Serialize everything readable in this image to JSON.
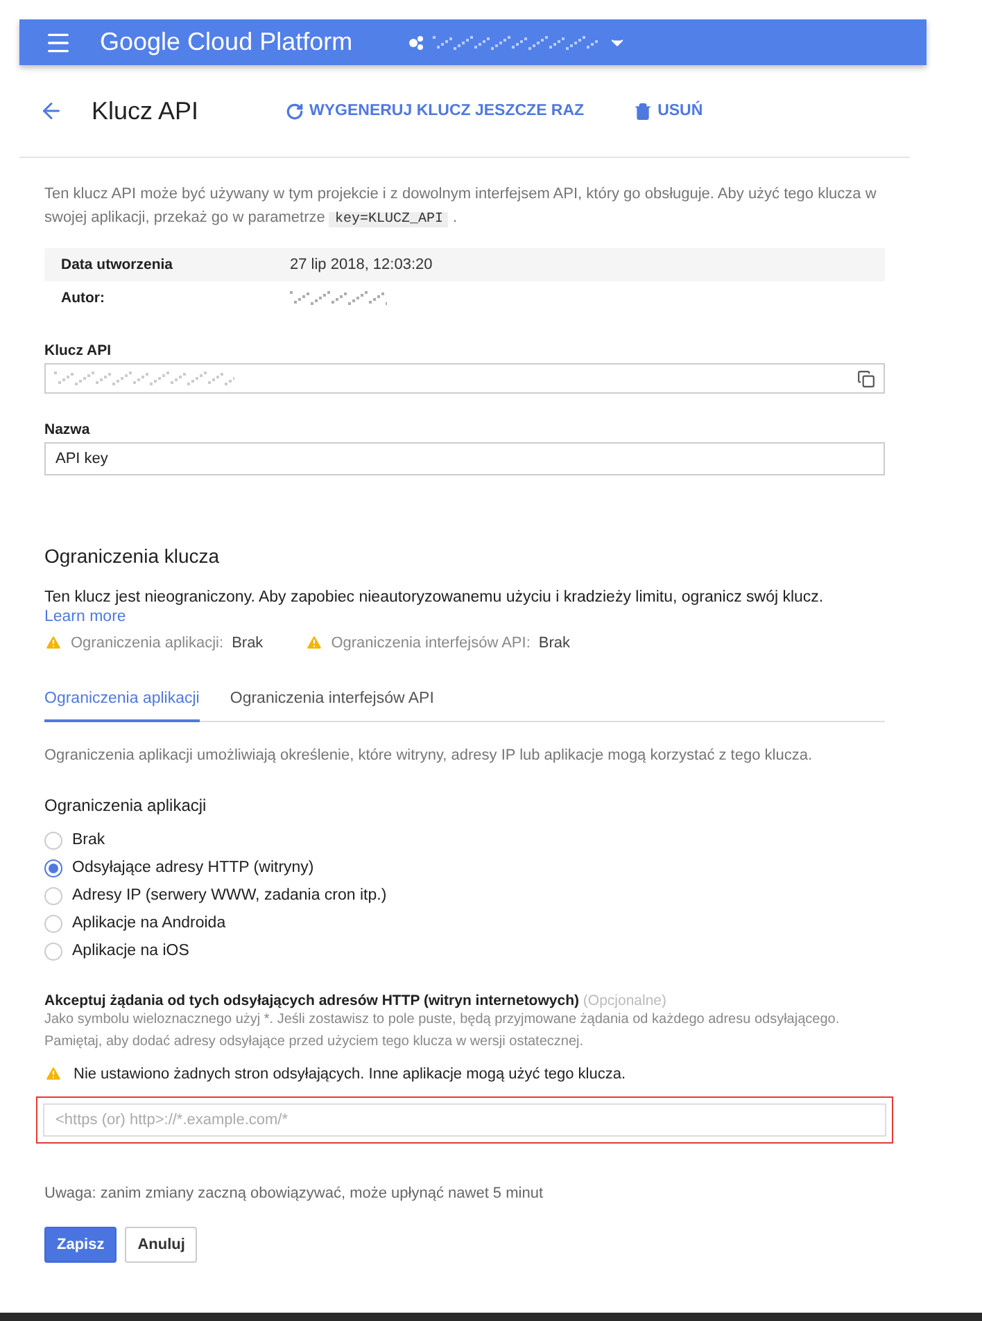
{
  "app_bar": {
    "brand": "Google Cloud Platform"
  },
  "header": {
    "title": "Klucz API",
    "actions": [
      {
        "kind": "regenerate",
        "label": "WYGENERUJ KLUCZ JESZCZE RAZ"
      },
      {
        "kind": "delete",
        "label": "USUŃ"
      }
    ]
  },
  "intro": {
    "text": "Ten klucz API może być używany w tym projekcie i z dowolnym interfejsem API, który go obsługuje. Aby użyć tego klucza w swojej aplikacji, przekaż go w parametrze",
    "code": "key=KLUCZ_API",
    "end": "."
  },
  "details": [
    {
      "label": "Data utworzenia",
      "value": "27 lip 2018, 12:03:20"
    },
    {
      "label": "Autor:"
    }
  ],
  "api_key": {
    "label": "Klucz API"
  },
  "name": {
    "label": "Nazwa",
    "value": "API key"
  },
  "restrictions": {
    "title": "Ograniczenia klucza",
    "text": "Ten klucz jest nieograniczony. Aby zapobiec nieautoryzowanemu użyciu i kradzieży limitu, ogranicz swój klucz.",
    "link": "Learn more",
    "statuses": [
      {
        "label": "Ograniczenia aplikacji:",
        "value": "Brak"
      },
      {
        "label": "Ograniczenia interfejsów API:",
        "value": "Brak"
      }
    ]
  },
  "tabs": [
    {
      "label": "Ograniczenia aplikacji",
      "selected": true
    },
    {
      "label": "Ograniczenia interfejsów API",
      "selected": false
    }
  ],
  "tab_text": "Ograniczenia aplikacji umożliwiają określenie, które witryny, adresy IP lub aplikacje mogą korzystać z tego klucza.",
  "app_restrictions": {
    "title": "Ograniczenia aplikacji",
    "options": [
      {
        "label": "Brak",
        "selected": false
      },
      {
        "label": "Odsyłające adresy HTTP (witryny)",
        "selected": true
      },
      {
        "label": "Adresy IP (serwery WWW, zadania cron itp.)",
        "selected": false
      },
      {
        "label": "Aplikacje na Androida",
        "selected": false
      },
      {
        "label": "Aplikacje na iOS",
        "selected": false
      }
    ]
  },
  "referrers": {
    "label": "Akceptuj żądania od tych odsyłających adresów HTTP (witryn internetowych)",
    "optional": "(Opcjonalne)",
    "help": "Jako symbolu wieloznacznego użyj *. Jeśli zostawisz to pole puste, będą przyjmowane żądania od każdego adresu odsyłającego. Pamiętaj, aby dodać adresy odsyłające przed użyciem tego klucza w wersji ostatecznej.",
    "warning": "Nie ustawiono żadnych stron odsyłających. Inne aplikacje mogą użyć tego klucza.",
    "placeholder": "<https (or) http>://*.example.com/*",
    "highlighted": true
  },
  "note": "Uwaga: zanim zmiany zaczną obowiązywać, może upłynąć nawet 5 minut",
  "buttons": [
    {
      "kind": "primary",
      "label": "Zapisz"
    },
    {
      "kind": "secondary",
      "label": "Anuluj"
    }
  ]
}
